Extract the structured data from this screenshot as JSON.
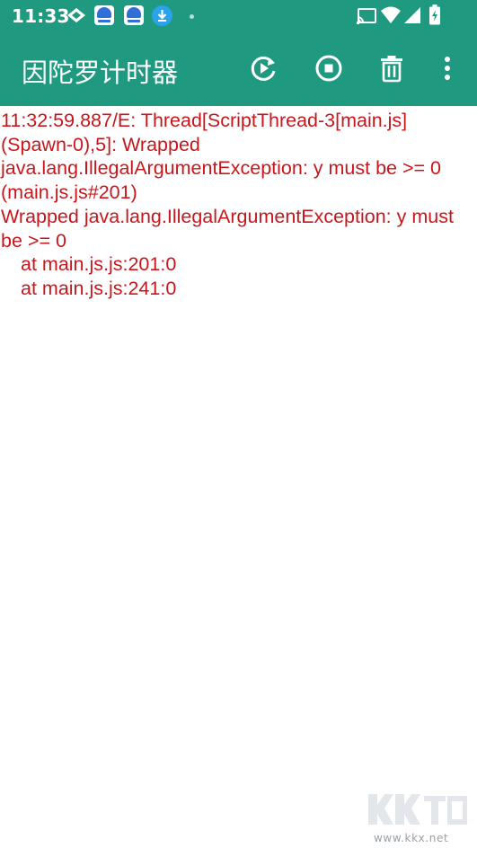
{
  "status_bar": {
    "time": "11:33",
    "icons": [
      "signal-arrows-icon",
      "app-badge-icon",
      "app-badge-icon",
      "download-icon",
      "notification-dot-icon",
      "cast-icon",
      "wifi-icon",
      "cellular-icon",
      "battery-charging-icon"
    ]
  },
  "toolbar": {
    "title": "因陀罗计时器",
    "actions": [
      "rerun-icon",
      "stop-icon",
      "delete-icon",
      "overflow-menu-icon"
    ]
  },
  "log": {
    "lines": [
      {
        "text": "11:32:59.887/E: Thread[ScriptThread-3[main.js](Spawn-0),5]: Wrapped java.lang.IllegalArgumentException: y must be >= 0 (main.js.js#201)",
        "indent": false
      },
      {
        "text": "Wrapped java.lang.IllegalArgumentException: y must be >= 0",
        "indent": false
      },
      {
        "text": "at main.js.js:201:0",
        "indent": true
      },
      {
        "text": "at main.js.js:241:0",
        "indent": true
      }
    ]
  },
  "watermark": {
    "domain": "www.kkx.net"
  },
  "colors": {
    "primary": "#1f9a80",
    "error_text": "#c8171c",
    "background": "#ffffff"
  }
}
